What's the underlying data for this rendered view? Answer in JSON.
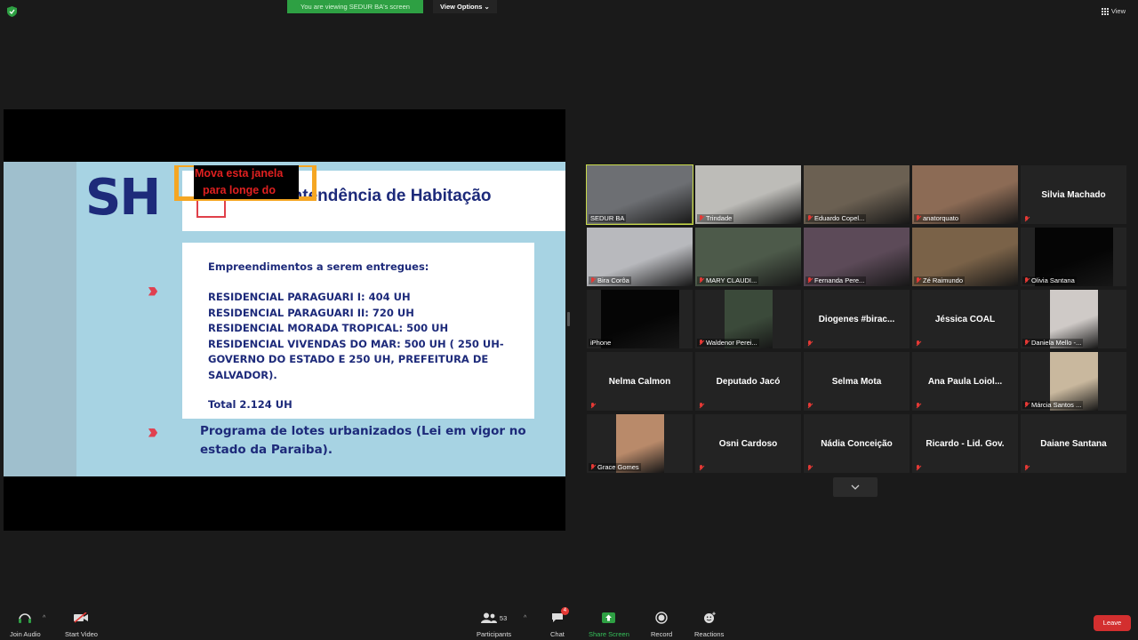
{
  "top_bar": {
    "viewing_banner": "You are viewing SEDUR BA's screen",
    "view_options_label": "View Options",
    "view_label": "View"
  },
  "slide": {
    "logo": "SH",
    "title": "rintendência de Habitação",
    "overlay_note_line1": "Mova esta janela",
    "overlay_note_line2": "para longe do",
    "list_header": "Empreendimentos a serem entregues:",
    "items": [
      "RESIDENCIAL PARAGUARI I: 404 UH",
      "RESIDENCIAL PARAGUARI II: 720 UH",
      "RESIDENCIAL MORADA TROPICAL: 500 UH",
      "RESIDENCIAL VIVENDAS DO MAR: 500 UH ( 250 UH-",
      "GOVERNO DO ESTADO E 250 UH, PREFEITURA DE SALVADOR)."
    ],
    "total": "Total 2.124 UH",
    "program_line1": "Programa de lotes urbanizados (Lei em vigor no",
    "program_line2": "estado da Paraiba)."
  },
  "participants": [
    {
      "name": "SEDUR BA",
      "video": true,
      "active": true,
      "muted": false,
      "color": "#6d6f73"
    },
    {
      "name": "Trindade",
      "video": true,
      "muted": true,
      "color": "#bdbcb8"
    },
    {
      "name": "Eduardo Copel...",
      "video": true,
      "muted": true,
      "color": "#6b6052"
    },
    {
      "name": "anatorquato",
      "video": true,
      "muted": true,
      "color": "#8c6b55"
    },
    {
      "name": "Silvia Machado",
      "video": false,
      "muted": true
    },
    {
      "name": "Bira Corôa",
      "video": true,
      "muted": true,
      "color": "#b8b9bd"
    },
    {
      "name": "MARY CLAUDI...",
      "video": true,
      "muted": true,
      "color": "#4d5a4a"
    },
    {
      "name": "Fernanda Pere...",
      "video": true,
      "muted": true,
      "color": "#5c4a58"
    },
    {
      "name": "Zé Raimundo",
      "video": true,
      "muted": true,
      "color": "#7a6248"
    },
    {
      "name": "Olivia Santana",
      "video": true,
      "muted": true,
      "color": "#050505"
    },
    {
      "name": "iPhone",
      "video": true,
      "muted": false,
      "color": "#050505"
    },
    {
      "name": "Waldenor Perei...",
      "video": true,
      "muted": true,
      "color": "#3b4a3a"
    },
    {
      "name": "Diogenes  #birac...",
      "video": false,
      "muted": true
    },
    {
      "name": "Jéssica COAL",
      "video": false,
      "muted": true
    },
    {
      "name": "Daniela Mello -...",
      "video": true,
      "muted": true,
      "color": "#cfcac7"
    },
    {
      "name": "Nelma Calmon",
      "video": false,
      "muted": true
    },
    {
      "name": "Deputado Jacó",
      "video": false,
      "muted": true
    },
    {
      "name": "Selma Mota",
      "video": false,
      "muted": true
    },
    {
      "name": "Ana  Paula Loiol...",
      "video": false,
      "muted": true
    },
    {
      "name": "Márcia Santos ...",
      "video": true,
      "muted": true,
      "color": "#c9b89e"
    },
    {
      "name": "Grace Gomes",
      "video": true,
      "muted": true,
      "color": "#b98a6a"
    },
    {
      "name": "Osni Cardoso",
      "video": false,
      "muted": true
    },
    {
      "name": "Nádia Conceição",
      "video": false,
      "muted": true
    },
    {
      "name": "Ricardo - Lid. Gov.",
      "video": false,
      "muted": true
    },
    {
      "name": "Daiane Santana",
      "video": false,
      "muted": true
    }
  ],
  "toolbar": {
    "join_audio": "Join Audio",
    "start_video": "Start Video",
    "participants": "Participants",
    "participants_count": "53",
    "chat": "Chat",
    "chat_badge": "4",
    "share_screen": "Share Screen",
    "record": "Record",
    "reactions": "Reactions",
    "leave": "Leave"
  },
  "colors": {
    "share_green": "#2ea043",
    "leave_red": "#d32f2f",
    "active_speaker": "#c8d94a",
    "slide_navy": "#1d2a7a"
  }
}
